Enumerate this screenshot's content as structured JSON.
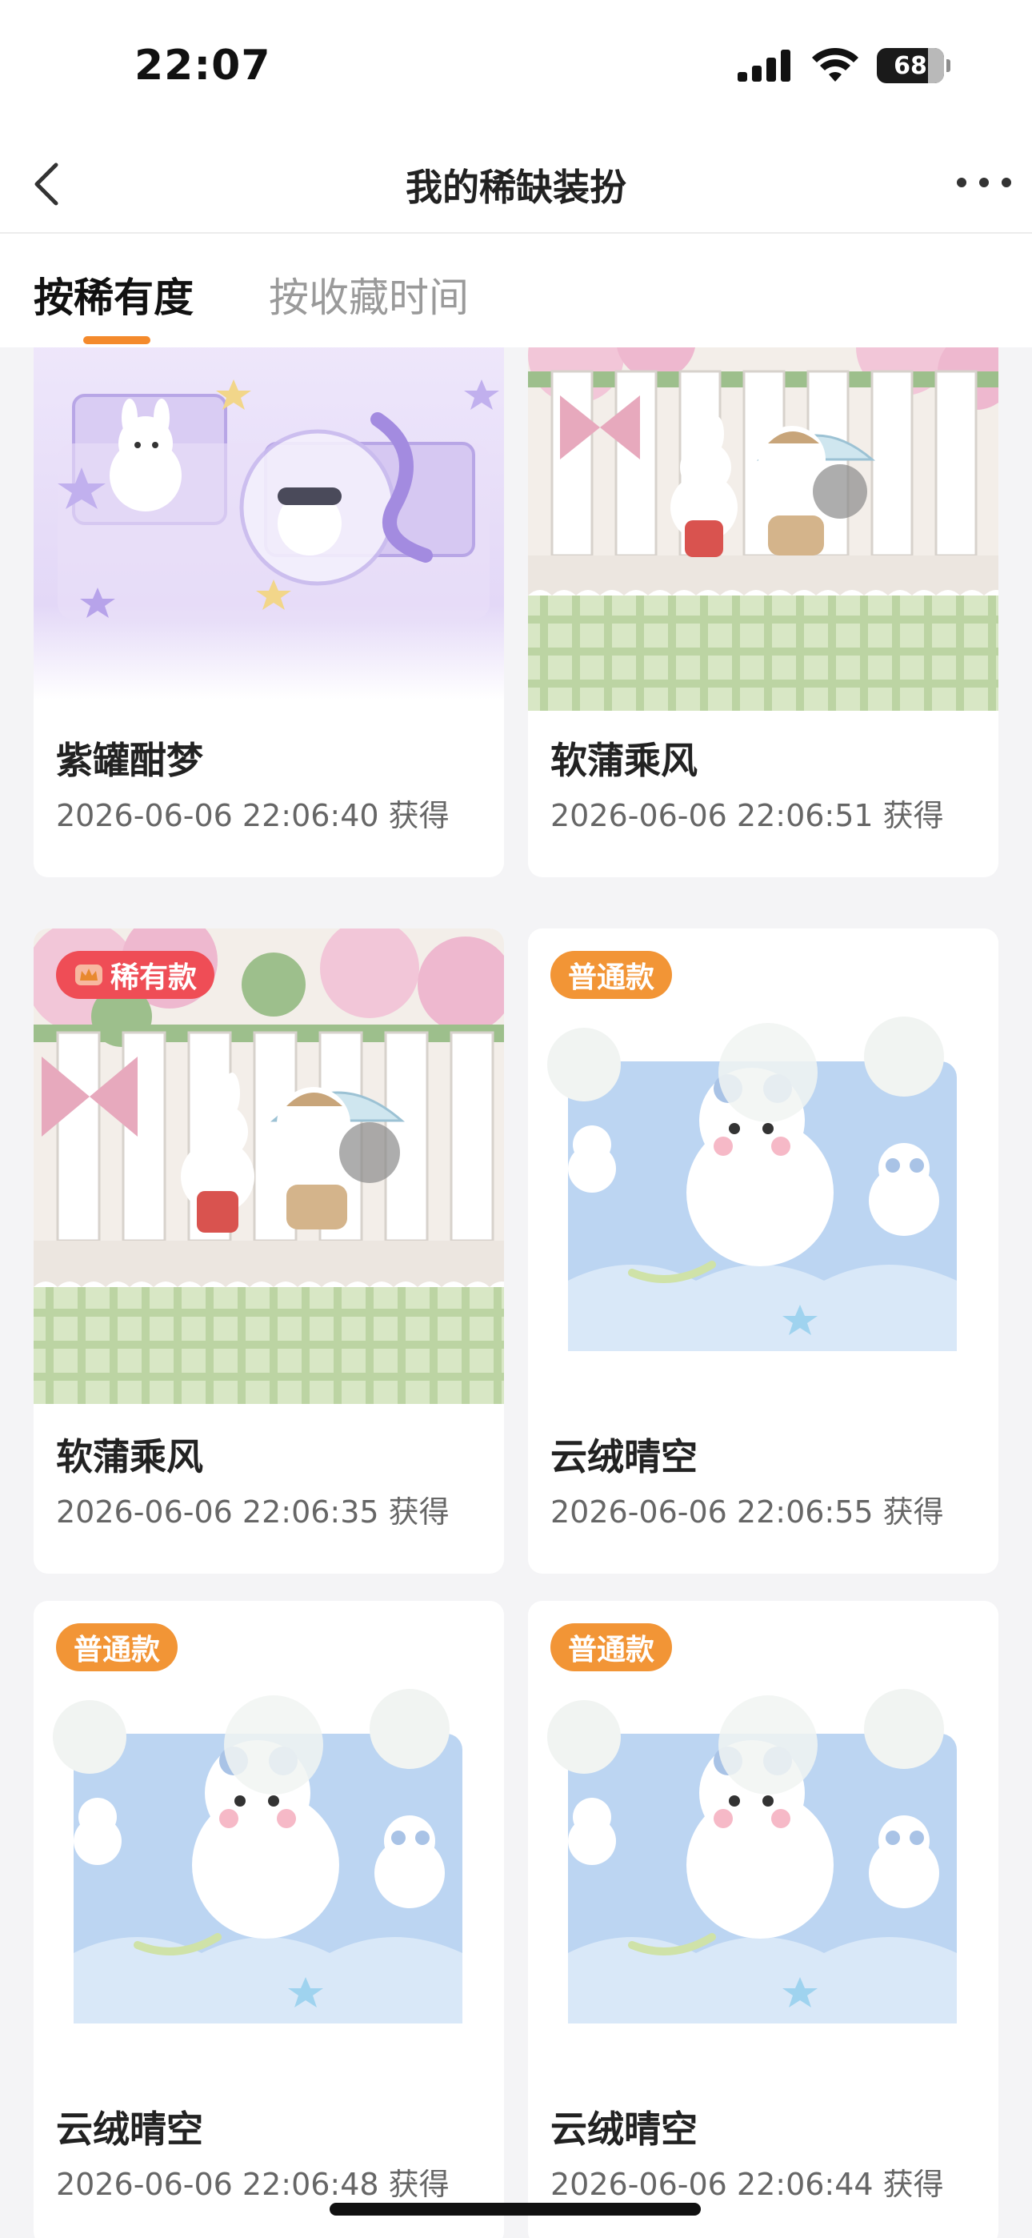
{
  "status": {
    "time": "22:07",
    "battery": "68"
  },
  "nav": {
    "title": "我的稀缺装扮"
  },
  "tabs": [
    {
      "label": "按稀有度",
      "active": true
    },
    {
      "label": "按收藏时间",
      "active": false
    }
  ],
  "cards": [
    {
      "name": "紫罐酣梦",
      "time": "2026-06-06 22:06:40 获得",
      "badge": "",
      "theme": "purple-jar"
    },
    {
      "name": "软蒲乘风",
      "time": "2026-06-06 22:06:51 获得",
      "badge": "",
      "theme": "garden"
    },
    {
      "name": "软蒲乘风",
      "time": "2026-06-06 22:06:35 获得",
      "badge": "稀有款",
      "badge_type": "rare",
      "theme": "garden"
    },
    {
      "name": "云绒晴空",
      "time": "2026-06-06 22:06:55 获得",
      "badge": "普通款",
      "badge_type": "normal",
      "theme": "sky"
    },
    {
      "name": "云绒晴空",
      "time": "2026-06-06 22:06:48 获得",
      "badge": "普通款",
      "badge_type": "normal",
      "theme": "sky"
    },
    {
      "name": "云绒晴空",
      "time": "2026-06-06 22:06:44 获得",
      "badge": "普通款",
      "badge_type": "normal",
      "theme": "sky"
    }
  ],
  "colors": {
    "accent": "#f48a2c",
    "rare": "#ef4d56",
    "normal": "#f29536"
  }
}
